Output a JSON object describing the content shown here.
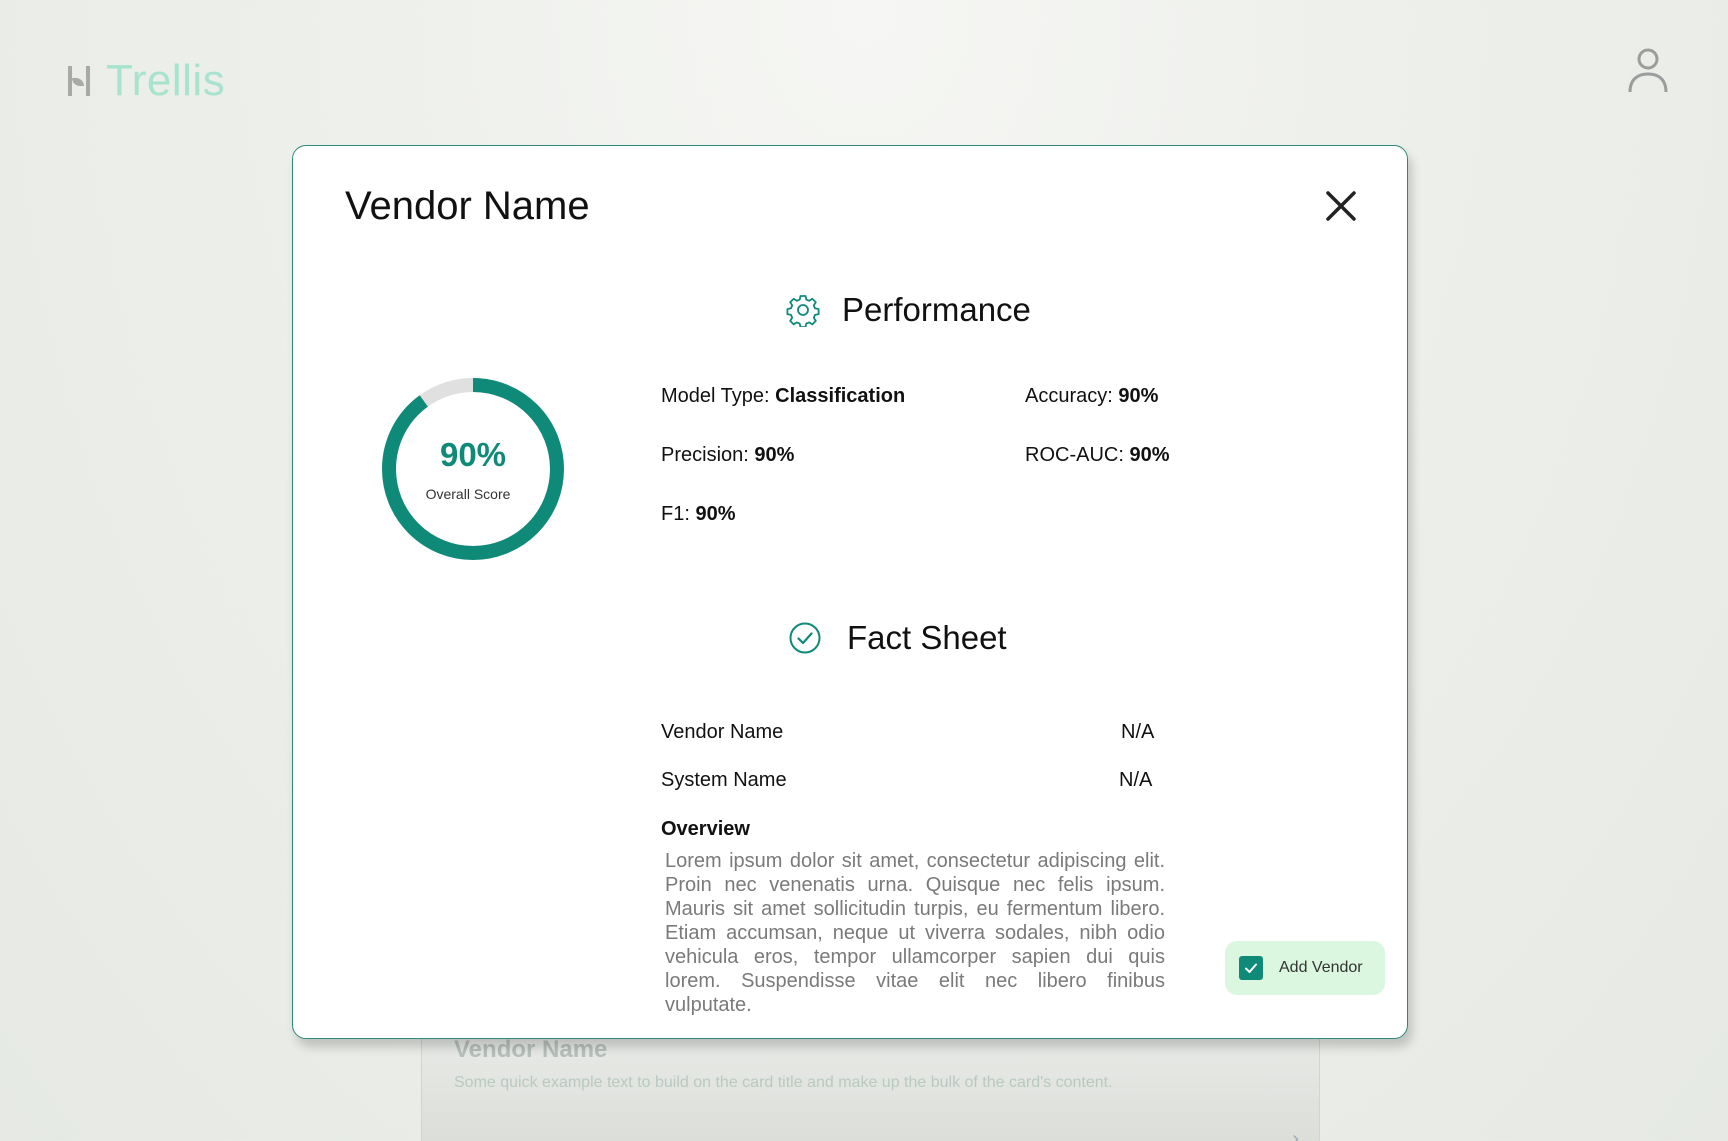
{
  "app": {
    "brand": "Trellis"
  },
  "background_card": {
    "title": "Vendor Name",
    "text": "Some quick example text to build on the card title and make up the bulk of the card's content."
  },
  "modal": {
    "title": "Vendor Name",
    "performance": {
      "heading": "Performance",
      "overall_score": "90%",
      "overall_score_fraction": 0.9,
      "overall_label": "Overall Score",
      "metrics": [
        {
          "label": "Model Type:",
          "value": "Classification"
        },
        {
          "label": "Accuracy:",
          "value": "90%"
        },
        {
          "label": "Precision:",
          "value": "90%"
        },
        {
          "label": "ROC-AUC:",
          "value": "90%"
        },
        {
          "label": "F1:",
          "value": "90%"
        }
      ]
    },
    "fact_sheet": {
      "heading": "Fact Sheet",
      "rows": [
        {
          "label": "Vendor Name",
          "value": "N/A"
        },
        {
          "label": "System Name",
          "value": "N/A"
        }
      ],
      "overview_label": "Overview",
      "overview_text": "Lorem ipsum dolor sit amet, consectetur adipiscing elit. Proin nec venenatis urna. Quisque nec felis ipsum. Mauris sit amet sollicitudin turpis, eu fermentum libero. Etiam accumsan, neque ut viverra sodales, nibh odio vehicula eros, tempor ullamcorper sapien dui quis lorem. Suspendisse vitae elit nec libero finibus vulputate."
    },
    "add_vendor": {
      "label": "Add Vendor",
      "checked": true
    }
  },
  "colors": {
    "accent": "#0f8a78",
    "track": "#e0e0e0",
    "button_bg": "#dbf7df",
    "brand_text": "#a7e3cf"
  }
}
